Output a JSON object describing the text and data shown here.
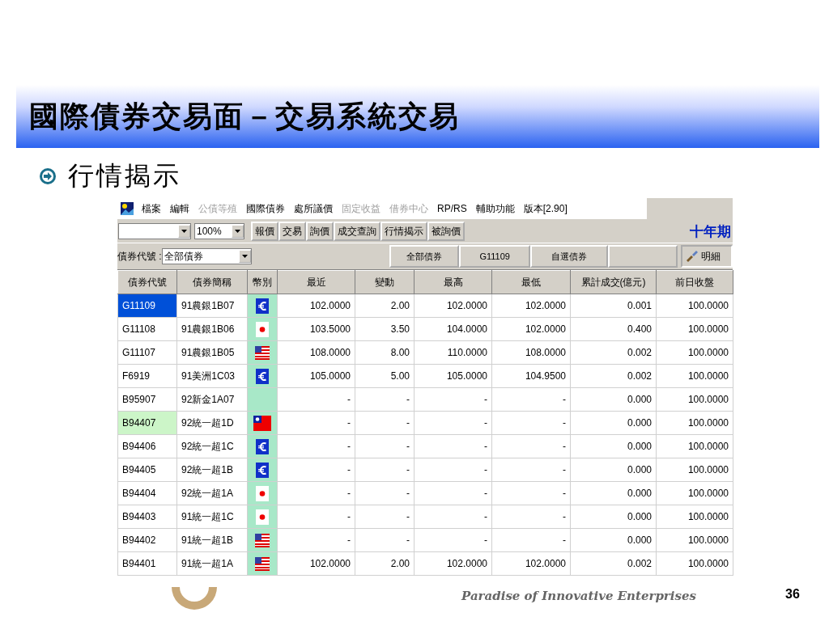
{
  "slide": {
    "title": "國際債券交易面－交易系統交易",
    "bullet": "行情揭示",
    "page_number": "36",
    "footer_tagline": "Paradise of Innovative Enterprises"
  },
  "menu": [
    {
      "label": "檔案",
      "disabled": false
    },
    {
      "label": "編輯",
      "disabled": false
    },
    {
      "label": "公債等殖",
      "disabled": true
    },
    {
      "label": "國際債券",
      "disabled": false
    },
    {
      "label": "處所議價",
      "disabled": false
    },
    {
      "label": "固定收益",
      "disabled": true
    },
    {
      "label": "借券中心",
      "disabled": true
    },
    {
      "label": "RP/RS",
      "disabled": false
    },
    {
      "label": "輔助功能",
      "disabled": false
    },
    {
      "label": "版本[2.90]",
      "disabled": false
    }
  ],
  "toolbar": {
    "zoom": "100%",
    "buttons": [
      "報價",
      "交易",
      "詢價",
      "成交查詢",
      "行情揭示",
      "被詢價"
    ],
    "banner": "十年期"
  },
  "filter": {
    "label": "債券代號 :",
    "value": "全部債券",
    "buttons": [
      "全部債券",
      "G11109",
      "自選債券"
    ],
    "detail_button": "明細"
  },
  "table": {
    "columns": [
      "債券代號",
      "債券簡稱",
      "幣別",
      "最近",
      "變動",
      "最高",
      "最低",
      "累計成交(億元)",
      "前日收盤"
    ],
    "rows": [
      {
        "code": "G11109",
        "name": "91農銀1B07",
        "kind": "eur",
        "last": "102.0000",
        "change": "2.00",
        "high": "102.0000",
        "low": "102.0000",
        "volume": "0.001",
        "prev_close": "100.0000",
        "selected": true,
        "marked": false
      },
      {
        "code": "G11108",
        "name": "91農銀1B06",
        "kind": "jpy",
        "last": "103.5000",
        "change": "3.50",
        "high": "104.0000",
        "low": "102.0000",
        "volume": "0.400",
        "prev_close": "100.0000",
        "selected": false,
        "marked": false
      },
      {
        "code": "G11107",
        "name": "91農銀1B05",
        "kind": "usd",
        "last": "108.0000",
        "change": "8.00",
        "high": "110.0000",
        "low": "108.0000",
        "volume": "0.002",
        "prev_close": "100.0000",
        "selected": false,
        "marked": false
      },
      {
        "code": "F6919",
        "name": "91美洲1C03",
        "kind": "eur",
        "last": "105.0000",
        "change": "5.00",
        "high": "105.0000",
        "low": "104.9500",
        "volume": "0.002",
        "prev_close": "100.0000",
        "selected": false,
        "marked": false
      },
      {
        "code": "B95907",
        "name": "92新金1A07",
        "kind": "none",
        "last": "-",
        "change": "-",
        "high": "-",
        "low": "-",
        "volume": "0.000",
        "prev_close": "100.0000",
        "selected": false,
        "marked": false
      },
      {
        "code": "B94407",
        "name": "92統一超1D",
        "kind": "twd",
        "last": "-",
        "change": "-",
        "high": "-",
        "low": "-",
        "volume": "0.000",
        "prev_close": "100.0000",
        "selected": false,
        "marked": true
      },
      {
        "code": "B94406",
        "name": "92統一超1C",
        "kind": "eur",
        "last": "-",
        "change": "-",
        "high": "-",
        "low": "-",
        "volume": "0.000",
        "prev_close": "100.0000",
        "selected": false,
        "marked": false
      },
      {
        "code": "B94405",
        "name": "92統一超1B",
        "kind": "eur",
        "last": "-",
        "change": "-",
        "high": "-",
        "low": "-",
        "volume": "0.000",
        "prev_close": "100.0000",
        "selected": false,
        "marked": false
      },
      {
        "code": "B94404",
        "name": "92統一超1A",
        "kind": "jpy",
        "last": "-",
        "change": "-",
        "high": "-",
        "low": "-",
        "volume": "0.000",
        "prev_close": "100.0000",
        "selected": false,
        "marked": false
      },
      {
        "code": "B94403",
        "name": "91統一超1C",
        "kind": "jpy",
        "last": "-",
        "change": "-",
        "high": "-",
        "low": "-",
        "volume": "0.000",
        "prev_close": "100.0000",
        "selected": false,
        "marked": false
      },
      {
        "code": "B94402",
        "name": "91統一超1B",
        "kind": "usd",
        "last": "-",
        "change": "-",
        "high": "-",
        "low": "-",
        "volume": "0.000",
        "prev_close": "100.0000",
        "selected": false,
        "marked": false
      },
      {
        "code": "B94401",
        "name": "91統一超1A",
        "kind": "usd",
        "last": "102.0000",
        "change": "2.00",
        "high": "102.0000",
        "low": "102.0000",
        "volume": "0.002",
        "prev_close": "100.0000",
        "selected": false,
        "marked": false
      }
    ]
  }
}
